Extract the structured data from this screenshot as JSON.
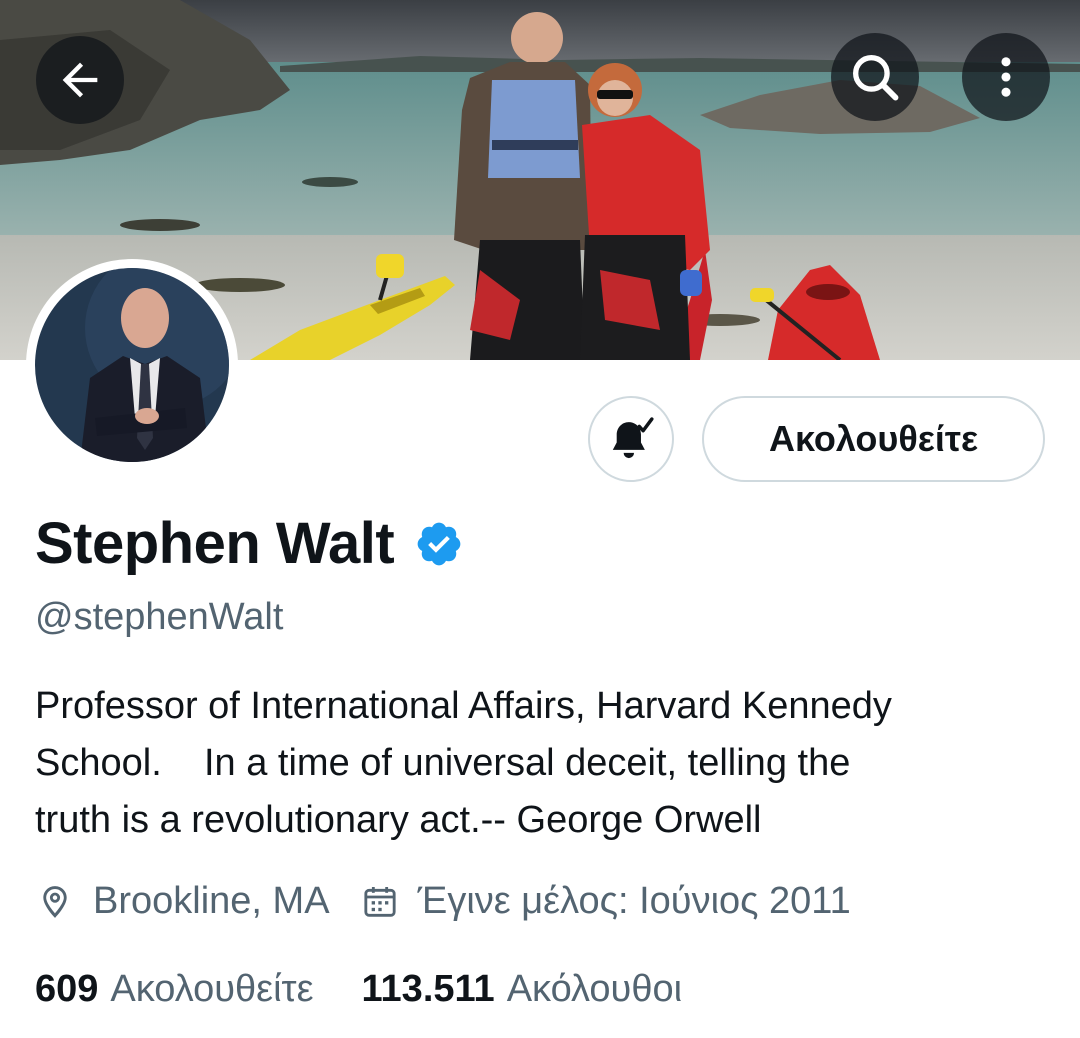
{
  "profile": {
    "name": "Stephen Walt",
    "handle": "@stephenWalt",
    "verified": true,
    "bio_lines": [
      "Professor of International Affairs, Harvard Kennedy",
      "School.    In a time of universal deceit, telling the",
      "truth is a revolutionary act.-- George Orwell"
    ],
    "location": "Brookline, MA",
    "joined": "Έγινε μέλος: Ιούνιος 2011"
  },
  "stats": {
    "following_count": "609",
    "following_label": "Ακολουθείτε",
    "followers_count": "113.511",
    "followers_label": "Ακόλουθοι"
  },
  "actions": {
    "follow_button_label": "Ακολουθείτε",
    "notification_icon": "bell-check-icon"
  },
  "header_icons": {
    "back": "arrow-left-icon",
    "search": "search-icon",
    "more": "more-vertical-icon"
  },
  "colors": {
    "verified_blue": "#1d9bf0",
    "secondary_text": "#536471",
    "border": "#cfd9de"
  }
}
